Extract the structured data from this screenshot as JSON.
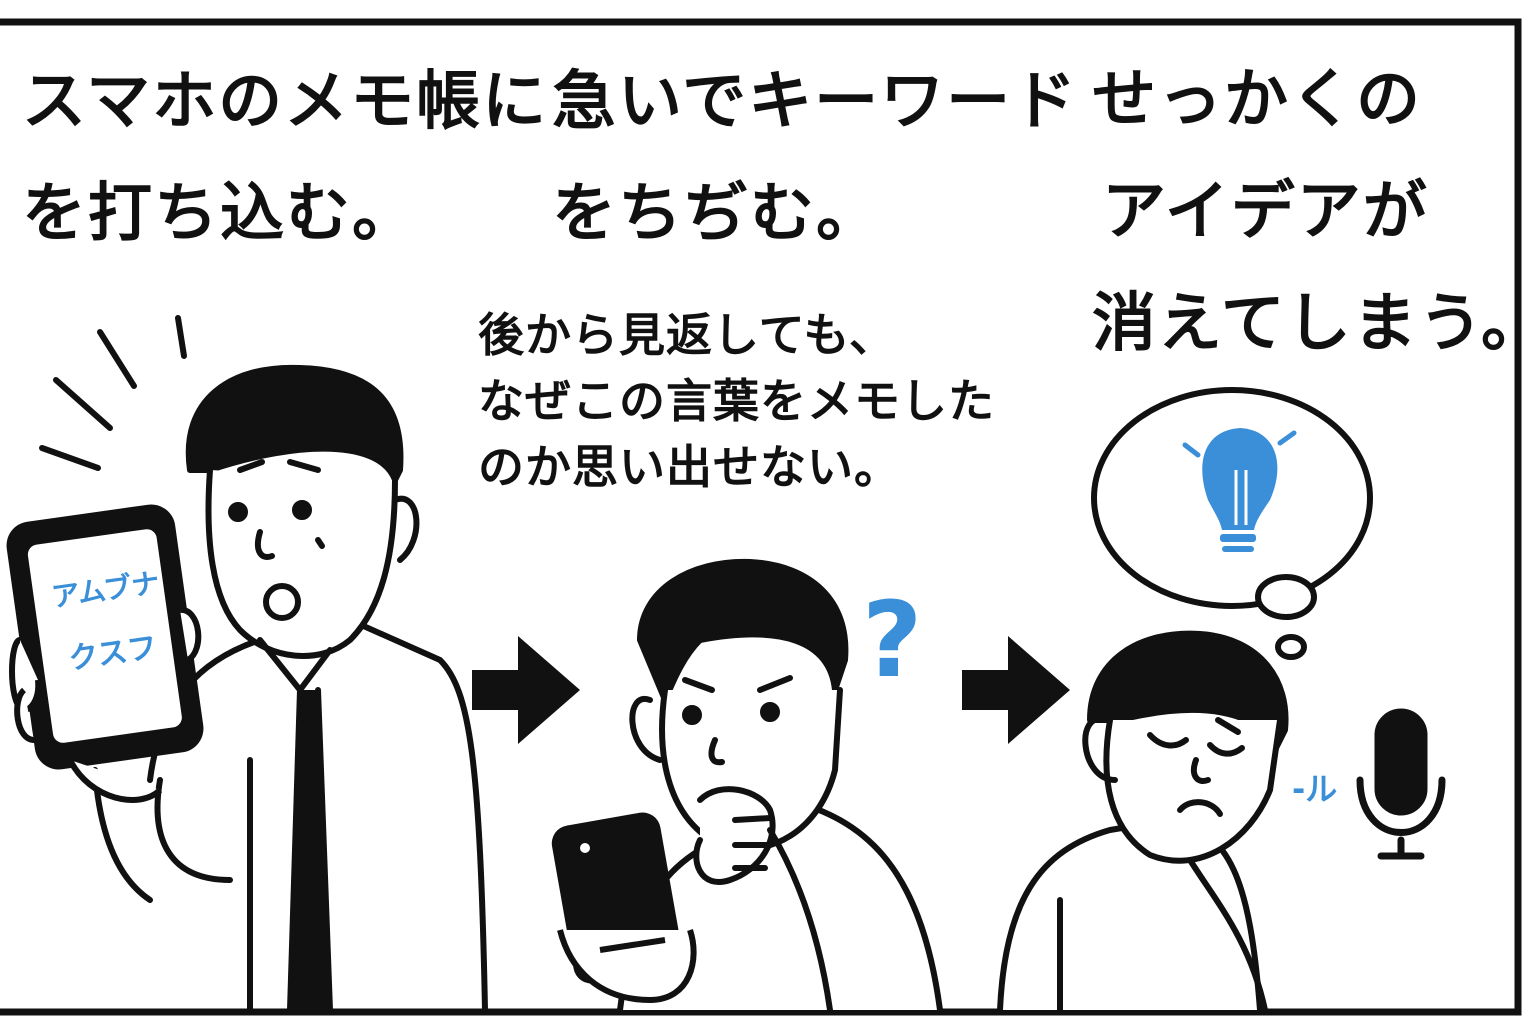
{
  "captions": {
    "panel1": {
      "line1": "スマホのメモ帳に",
      "line2": "を打ち込む。"
    },
    "panel2_top": {
      "line1": "急いでキーワード",
      "line2": "をちぢむ。"
    },
    "panel2_bottom": {
      "line1": "後から見返しても、",
      "line2": "なぜこの言葉をメモした",
      "line3": "のか思い出せない。"
    },
    "panel3": {
      "line1": "せっかくの",
      "line2": "アイデアが",
      "line3": "消えてしまう。"
    }
  },
  "phone_screen": {
    "line1": "アムブナ",
    "line2": "クスフ"
  },
  "question_mark": "?",
  "mic_sound": "-ル",
  "icons": [
    "smartphone-icon",
    "arrow-right-icon",
    "question-mark-icon",
    "lightbulb-icon",
    "microphone-icon",
    "thought-bubble-icon"
  ],
  "colors": {
    "ink": "#111111",
    "accent": "#3a8fd8",
    "background": "#ffffff"
  }
}
